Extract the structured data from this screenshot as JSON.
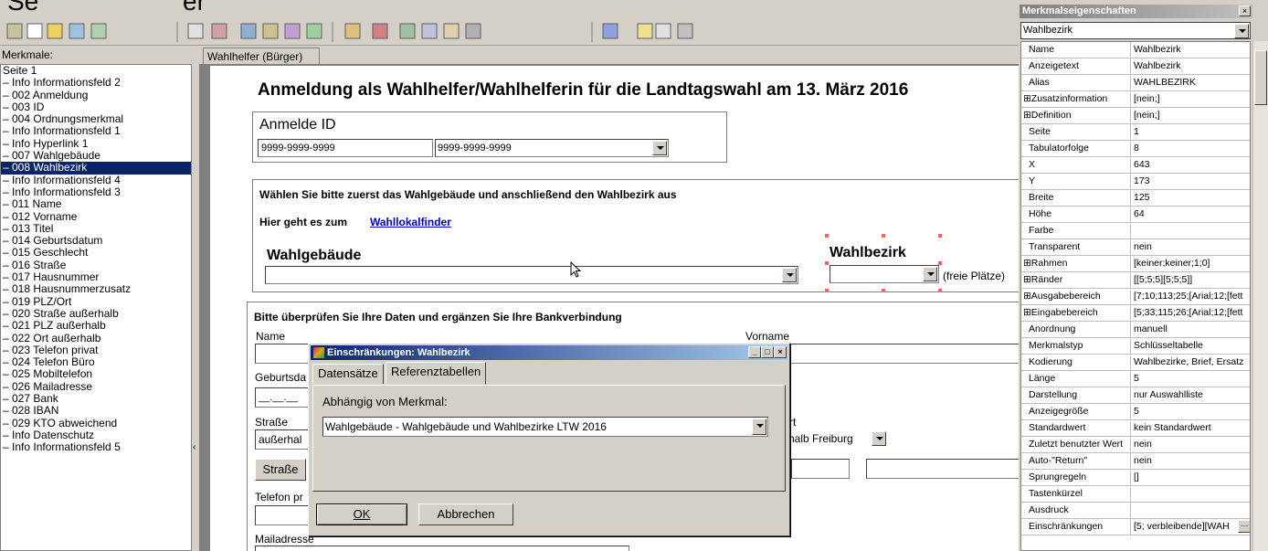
{
  "top_strip": {
    "partial_text_left": "Se",
    "partial_text_mid": "er"
  },
  "left_panel": {
    "header": "Merkmale:",
    "items": [
      {
        "label": "Seite 1"
      },
      {
        "label": "– Info Informationsfeld 2"
      },
      {
        "label": "– 002 Anmeldung"
      },
      {
        "label": "– 003 ID"
      },
      {
        "label": "– 004 Ordnungsmerkmal"
      },
      {
        "label": "– Info Informationsfeld 1"
      },
      {
        "label": "– Info Hyperlink 1"
      },
      {
        "label": "– 007 Wahlgebäude"
      },
      {
        "label": "– 008 Wahlbezirk",
        "selected": true
      },
      {
        "label": "– Info Informationsfeld 4"
      },
      {
        "label": "– Info Informationsfeld 3"
      },
      {
        "label": "– 011 Name"
      },
      {
        "label": "– 012 Vorname"
      },
      {
        "label": "– 013 Titel"
      },
      {
        "label": "– 014 Geburtsdatum"
      },
      {
        "label": "– 015 Geschlecht"
      },
      {
        "label": "– 016 Straße"
      },
      {
        "label": "– 017 Hausnummer"
      },
      {
        "label": "– 018 Hausnummerzusatz"
      },
      {
        "label": "– 019 PLZ/Ort"
      },
      {
        "label": "– 020 Straße außerhalb"
      },
      {
        "label": "– 021 PLZ außerhalb"
      },
      {
        "label": "– 022 Ort außerhalb"
      },
      {
        "label": "– 023 Telefon privat"
      },
      {
        "label": "– 024 Telefon Büro"
      },
      {
        "label": "– 025 Mobiltelefon"
      },
      {
        "label": "– 026 Mailadresse"
      },
      {
        "label": "– 027 Bank"
      },
      {
        "label": "– 028 IBAN"
      },
      {
        "label": "– 029 KTO abweichend"
      },
      {
        "label": "– Info Datenschutz"
      },
      {
        "label": "– Info Informationsfeld 5"
      }
    ]
  },
  "doc": {
    "tab": "Wahlhelfer (Bürger)",
    "title": "Anmeldung als Wahlhelfer/Wahlhelferin für die Landtagswahl am 13. März 2016",
    "anmelde_id": {
      "label": "Anmelde ID",
      "value1": "9999-9999-9999",
      "value2": "9999-9999-9999"
    },
    "instruction": "Wählen Sie bitte zuerst das Wahlgebäude und anschließend den Wahlbezirk aus",
    "link_prefix": "Hier geht es zum",
    "link_text": "Wahllokalfinder",
    "wahlgebaeude_label": "Wahlgebäude",
    "wahlbezirk_label": "Wahlbezirk",
    "freie_plaetze": "(freie Plätze)",
    "check_text": "Bitte überprüfen Sie Ihre Daten und ergänzen Sie Ihre Bankverbindung",
    "name_label": "Name",
    "vorname_label": "Vorname",
    "geburts_label": "Geburtsda",
    "date_mask": "__.__.__",
    "strasse_label": "Straße",
    "strasse_value": "außerhal",
    "ort_label": "rt",
    "ort_value": "rhalb Freiburg",
    "strasse_btn": "Straße",
    "telefon_label": "Telefon pr",
    "mail_label": "Mailadresse"
  },
  "dialog": {
    "title": "Einschränkungen: Wahlbezirk",
    "tabs": [
      "Datensätze",
      "Referenztabellen"
    ],
    "depends_label": "Abhängig von Merkmal:",
    "depends_value": "Wahlgebäude - Wahlgebäude und Wahlbezirke LTW 2016",
    "ok": "OK",
    "cancel": "Abbrechen"
  },
  "properties": {
    "title": "Merkmalseigenschaften",
    "object": "Wahlbezirk",
    "rows": [
      {
        "name": "Name",
        "value": "Wahlbezirk"
      },
      {
        "name": "Anzeigetext",
        "value": "Wahlbezirk"
      },
      {
        "name": "Alias",
        "value": "WAHLBEZIRK"
      },
      {
        "name": "⊞Zusatzinformation",
        "value": "[nein;]",
        "expand": true
      },
      {
        "name": "⊞Definition",
        "value": "[nein;]",
        "expand": true
      },
      {
        "name": "Seite",
        "value": "1"
      },
      {
        "name": "Tabulatorfolge",
        "value": "8"
      },
      {
        "name": "X",
        "value": "643"
      },
      {
        "name": "Y",
        "value": "173"
      },
      {
        "name": "Breite",
        "value": "125"
      },
      {
        "name": "Höhe",
        "value": "64"
      },
      {
        "name": "Farbe",
        "value": ""
      },
      {
        "name": "Transparent",
        "value": "nein"
      },
      {
        "name": "⊞Rahmen",
        "value": "[keiner;keiner;1;0]",
        "expand": true
      },
      {
        "name": "⊞Ränder",
        "value": "[[5;5;5][5;5;5]]",
        "expand": true
      },
      {
        "name": "⊞Ausgabebereich",
        "value": "[7;10;113;25;[Arial;12;[fett",
        "expand": true
      },
      {
        "name": "⊞Eingabebereich",
        "value": "[5;33;115;26;[Arial;12;[fett",
        "expand": true
      },
      {
        "name": "Anordnung",
        "value": "manuell"
      },
      {
        "name": "Merkmalstyp",
        "value": "Schlüsseltabelle"
      },
      {
        "name": "Kodierung",
        "value": "Wahlbezirke, Brief, Ersatz"
      },
      {
        "name": "Länge",
        "value": "5"
      },
      {
        "name": "Darstellung",
        "value": "nur Auswahlliste"
      },
      {
        "name": "Anzeigegröße",
        "value": "5"
      },
      {
        "name": "Standardwert",
        "value": "kein Standardwert"
      },
      {
        "name": "Zuletzt benutzter Wert",
        "value": "nein"
      },
      {
        "name": "Auto-\"Return\"",
        "value": "nein"
      },
      {
        "name": "Sprungregeln",
        "value": "[]"
      },
      {
        "name": "Tastenkürzel",
        "value": ""
      },
      {
        "name": "Ausdruck",
        "value": ""
      },
      {
        "name": "Einschränkungen",
        "value": "[5; verbleibende][WAH",
        "selected": true
      }
    ]
  },
  "colors": {
    "selection": "#0a246a",
    "link": "#0000cc",
    "handle": "#ff6060"
  }
}
